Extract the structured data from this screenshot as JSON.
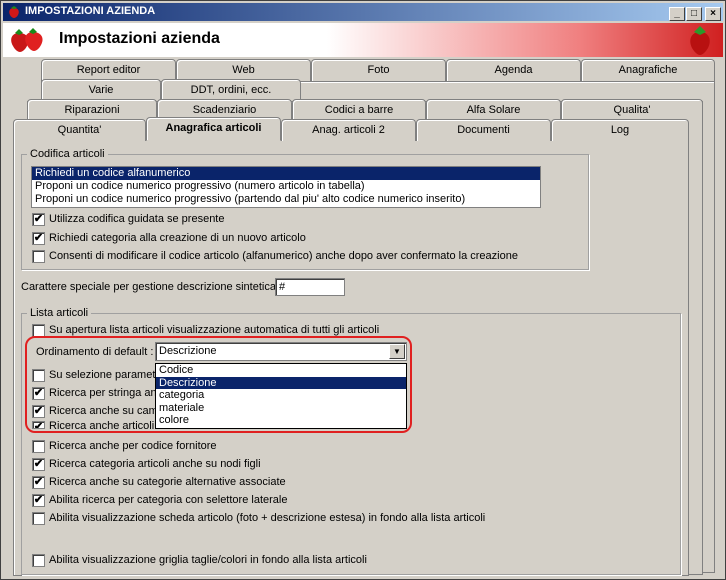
{
  "window": {
    "title": "IMPOSTAZIONI AZIENDA",
    "header_title": "Impostazioni azienda",
    "buttons": {
      "minimize": "_",
      "maximize": "□",
      "close": "×"
    }
  },
  "tabs": {
    "row1": [
      "Report editor",
      "Web",
      "Foto",
      "Agenda",
      "Anagrafiche"
    ],
    "row2": [
      "Varie",
      "DDT, ordini, ecc."
    ],
    "row3": [
      "Riparazioni",
      "Scadenziario",
      "Codici a barre",
      "Alfa Solare",
      "Qualita'"
    ],
    "row4": [
      "Quantita'",
      "Anagrafica articoli",
      "Anag. articoli 2",
      "Documenti",
      "Log"
    ]
  },
  "codifica": {
    "title": "Codifica articoli",
    "options": [
      "Richiedi un codice alfanumerico",
      "Proponi un codice numerico progressivo (numero articolo in tabella)",
      "Proponi un codice numerico progressivo (partendo dal piu' alto codice numerico inserito)"
    ],
    "checks": [
      {
        "label": "Utilizza codifica guidata se presente",
        "mark": "✔"
      },
      {
        "label": "Richiedi categoria alla creazione di un nuovo articolo",
        "mark": "✔"
      },
      {
        "label": "Consenti di modificare il codice articolo (alfanumerico) anche dopo aver confermato la creazione",
        "mark": ""
      }
    ]
  },
  "carattere": {
    "label": "Carattere speciale per gestione descrizione sintetica :",
    "value": "#"
  },
  "lista": {
    "title": "Lista articoli",
    "auto_check": {
      "label": "Su apertura lista articoli visualizzazione automatica di tutti gli articoli",
      "mark": ""
    },
    "ordinamento_label": "Ordinamento di default :",
    "ordinamento_value": "Descrizione",
    "dropdown_options": [
      "Codice",
      "Descrizione",
      "categoria",
      "materiale",
      "colore"
    ],
    "partial_checks": [
      {
        "label": "Su selezione parametri",
        "mark": ""
      },
      {
        "label": "Ricerca per stringa anc",
        "mark": "✔"
      },
      {
        "label": "Ricerca anche su cam",
        "mark": "✔"
      },
      {
        "label": "Ricerca anche articoli",
        "mark": "✔"
      }
    ],
    "checks": [
      {
        "label": "Ricerca anche per codice fornitore",
        "mark": ""
      },
      {
        "label": "Ricerca categoria articoli anche su nodi figli",
        "mark": "✔"
      },
      {
        "label": "Ricerca anche su categorie alternative associate",
        "mark": "✔"
      },
      {
        "label": "Abilita ricerca per categoria con selettore laterale",
        "mark": "✔"
      },
      {
        "label": "Abilita visualizzazione scheda articolo (foto + descrizione estesa) in fondo alla lista articoli",
        "mark": ""
      }
    ],
    "griglia_check": {
      "label": "Abilita visualizzazione griglia taglie/colori in fondo alla lista articoli",
      "mark": ""
    }
  }
}
